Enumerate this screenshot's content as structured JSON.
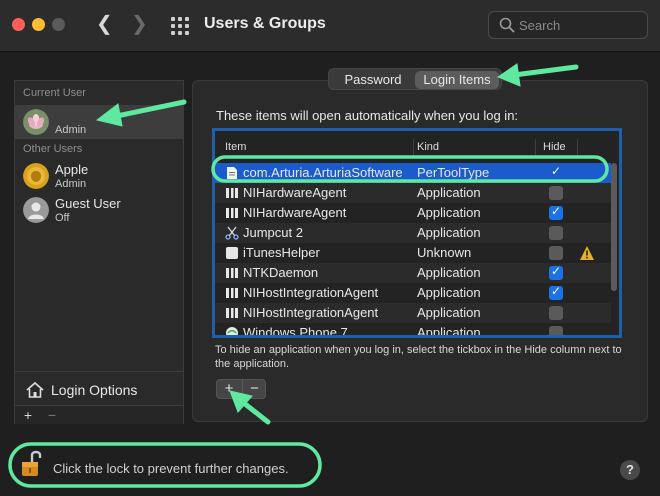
{
  "window": {
    "title": "Users & Groups"
  },
  "search": {
    "placeholder": "Search"
  },
  "sidebar": {
    "current_user_header": "Current User",
    "current_user": {
      "name": "",
      "role": "Admin"
    },
    "other_users_header": "Other Users",
    "other_users": [
      {
        "name": "Apple",
        "role": "Admin"
      },
      {
        "name": "Guest User",
        "role": "Off"
      }
    ],
    "login_options_label": "Login Options",
    "add_label": "+",
    "remove_label": "−"
  },
  "tabs": [
    {
      "label": "Password",
      "selected": false
    },
    {
      "label": "Login Items",
      "selected": true
    }
  ],
  "login_items": {
    "intro": "These items will open automatically when you log in:",
    "columns": {
      "item": "Item",
      "kind": "Kind",
      "hide": "Hide"
    },
    "rows": [
      {
        "name": "com.Arturia.ArturiaSoftware",
        "kind": "PerToolType",
        "hide": true,
        "selected": true,
        "icon": "document-icon"
      },
      {
        "name": "NIHardwareAgent",
        "kind": "Application",
        "hide": false,
        "icon": "ni-icon"
      },
      {
        "name": "NIHardwareAgent",
        "kind": "Application",
        "hide": true,
        "icon": "ni-icon"
      },
      {
        "name": "Jumpcut 2",
        "kind": "Application",
        "hide": false,
        "icon": "scissors-icon"
      },
      {
        "name": "iTunesHelper",
        "kind": "Unknown",
        "hide": false,
        "warning": true,
        "icon": "blank-app-icon"
      },
      {
        "name": "NTKDaemon",
        "kind": "Application",
        "hide": true,
        "icon": "ni-icon"
      },
      {
        "name": "NIHostIntegrationAgent",
        "kind": "Application",
        "hide": true,
        "icon": "ni-icon"
      },
      {
        "name": "NIHostIntegrationAgent",
        "kind": "Application",
        "hide": false,
        "icon": "ni-icon"
      },
      {
        "name": "Windows Phone 7",
        "kind": "Application",
        "hide": false,
        "icon": "globe-icon"
      }
    ],
    "hint": "To hide an application when you log in, select the tickbox in the Hide column next to the application.",
    "add_label": "+",
    "remove_label": "−"
  },
  "footer": {
    "lock_text": "Click the lock to prevent further changes.",
    "help_label": "?"
  },
  "colors": {
    "selection": "#1a5ccc",
    "highlight_annotation": "#5ee8a0",
    "table_border": "#1f5fa8"
  }
}
